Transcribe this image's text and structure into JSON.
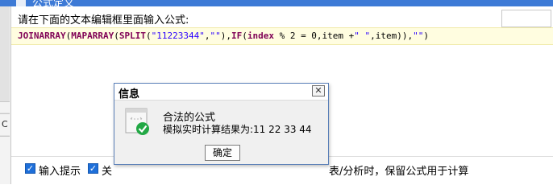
{
  "window": {
    "title": "公式定义"
  },
  "editor": {
    "prompt": "请在下面的文本编辑框里面输入公式:",
    "formula_tokens": [
      {
        "text": "JOINARRAY",
        "kind": "kw"
      },
      {
        "text": "(",
        "kind": "plain"
      },
      {
        "text": "MAPARRAY",
        "kind": "kw"
      },
      {
        "text": "(",
        "kind": "plain"
      },
      {
        "text": "SPLIT",
        "kind": "kw"
      },
      {
        "text": "(",
        "kind": "plain"
      },
      {
        "text": "\"11223344\"",
        "kind": "str"
      },
      {
        "text": ",",
        "kind": "plain"
      },
      {
        "text": "\"\"",
        "kind": "str"
      },
      {
        "text": "),",
        "kind": "plain"
      },
      {
        "text": "IF",
        "kind": "kw"
      },
      {
        "text": "(",
        "kind": "plain"
      },
      {
        "text": "index",
        "kind": "kw"
      },
      {
        "text": " % 2 = 0,item +",
        "kind": "plain"
      },
      {
        "text": "\" \"",
        "kind": "str"
      },
      {
        "text": ",item)),",
        "kind": "plain"
      },
      {
        "text": "\"\"",
        "kind": "str"
      },
      {
        "text": ")",
        "kind": "plain"
      }
    ]
  },
  "options": {
    "input_hint_label": "输入提示",
    "input_hint_checked": true,
    "second_label_partial": "关",
    "second_checked": true,
    "third_label_partial": "表/分析时，保留公式用于计算"
  },
  "message_box": {
    "title": "信息",
    "close_glyph": "✕",
    "line1": "合法的公式",
    "line2": "模拟实时计算结果为:11 22 33 44",
    "ok_label": "确定",
    "icon": "valid-formula-check-icon"
  },
  "sidebar": {
    "letter": "C"
  },
  "colors": {
    "keyword": "#7f0055",
    "string": "#2a00ff",
    "checkbox": "#1e6fd9",
    "editor_line_bg": "#fffde0",
    "check_badge": "#22a845"
  }
}
